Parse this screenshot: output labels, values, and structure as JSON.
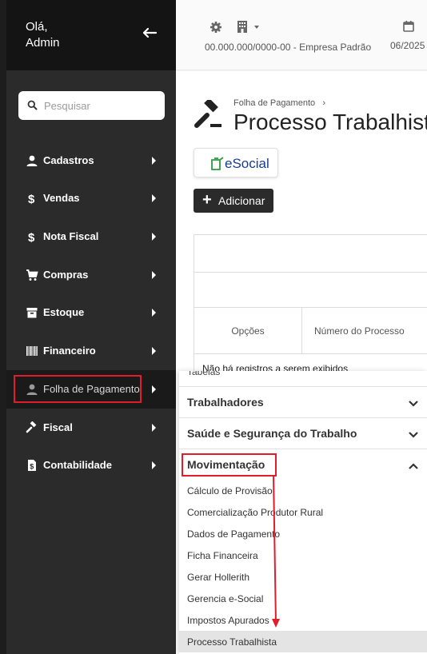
{
  "sidebar": {
    "greeting_line1": "Olá,",
    "greeting_line2": "Admin",
    "search_placeholder": "Pesquisar",
    "items": [
      {
        "label": "Cadastros",
        "icon": "user-icon"
      },
      {
        "label": "Vendas",
        "icon": "dollar-icon"
      },
      {
        "label": "Nota Fiscal",
        "icon": "dollar-icon"
      },
      {
        "label": "Compras",
        "icon": "cart-icon"
      },
      {
        "label": "Estoque",
        "icon": "archive-icon"
      },
      {
        "label": "Financeiro",
        "icon": "barcode-icon"
      },
      {
        "label": "Folha de Pagamento",
        "icon": "user-icon",
        "active": true
      },
      {
        "label": "Fiscal",
        "icon": "gavel-icon"
      },
      {
        "label": "Contabilidade",
        "icon": "file-dollar-icon"
      }
    ]
  },
  "topbar": {
    "company": "00.000.000/0000-00 - Empresa Padrão",
    "date": "06/2025"
  },
  "main": {
    "breadcrumb": "Folha de Pagamento",
    "title": "Processo Trabalhista",
    "esocial_label": "eSocial",
    "add_label": "Adicionar",
    "table": {
      "columns": [
        "Opções",
        "Número do Processo"
      ],
      "empty_message": "Não há registros a serem exibidos"
    }
  },
  "submenu": {
    "cut_label": "Tabelas",
    "sections": [
      {
        "label": "Trabalhadores",
        "expanded": false
      },
      {
        "label": "Saúde e Segurança do Trabalho",
        "expanded": false
      },
      {
        "label": "Movimentação",
        "expanded": true
      }
    ],
    "items": [
      "Cálculo de Provisão",
      "Comercialização Produtor Rural",
      "Dados de Pagamento",
      "Ficha Financeira",
      "Gerar Hollerith",
      "Gerencia e-Social",
      "Impostos Apurados",
      "Processo Trabalhista"
    ],
    "selected_item": "Processo Trabalhista"
  },
  "colors": {
    "sidebar_bg": "#2b2b2b",
    "sidebar_header_bg": "#141414",
    "annotation_red": "#e11d2a",
    "esocial_blue": "#1a3c8e"
  }
}
